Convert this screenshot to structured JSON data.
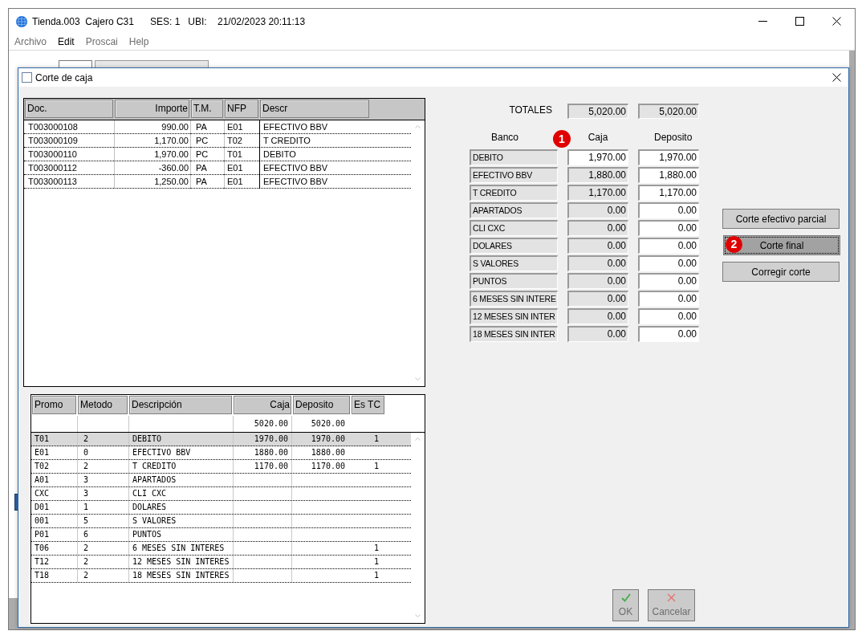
{
  "window": {
    "title": "Tienda.003  Cajero C31      SES: 1   UBI:    21/02/2023 20:11:13",
    "menu": [
      {
        "label": "Archivo",
        "disabled": true
      },
      {
        "label": "Edit",
        "disabled": false
      },
      {
        "label": "Proscai",
        "disabled": true
      },
      {
        "label": "Help",
        "disabled": true
      }
    ]
  },
  "dialog": {
    "title": "Corte de caja",
    "documents": {
      "columns": [
        "Doc.",
        "Importe",
        "T.M.",
        "NFP",
        "Descr"
      ],
      "rows": [
        {
          "doc": "T003000108",
          "importe": "990.00",
          "tm": "PA",
          "nfp": "E01",
          "descr": "EFECTIVO BBV"
        },
        {
          "doc": "T003000109",
          "importe": "1,170.00",
          "tm": "PC",
          "nfp": "T02",
          "descr": "T CREDITO"
        },
        {
          "doc": "T003000110",
          "importe": "1,970.00",
          "tm": "PC",
          "nfp": "T01",
          "descr": "DEBITO"
        },
        {
          "doc": "T003000112",
          "importe": "-360.00",
          "tm": "PA",
          "nfp": "E01",
          "descr": "EFECTIVO BBV"
        },
        {
          "doc": "T003000113",
          "importe": "1,250.00",
          "tm": "PA",
          "nfp": "E01",
          "descr": "EFECTIVO BBV"
        }
      ]
    },
    "totals": {
      "label": "TOTALES",
      "caja": "5,020.00",
      "deposito": "5,020.00"
    },
    "bank_headers": {
      "banco": "Banco",
      "caja": "Caja",
      "deposito": "Deposito",
      "callout": "1"
    },
    "banks": [
      {
        "name": "DEBITO",
        "caja": "1,970.00",
        "caja_disabled": false,
        "deposito": "1,970.00"
      },
      {
        "name": "EFECTIVO BBV",
        "caja": "1,880.00",
        "caja_disabled": true,
        "deposito": "1,880.00"
      },
      {
        "name": "T CREDITO",
        "caja": "1,170.00",
        "caja_disabled": true,
        "deposito": "1,170.00"
      },
      {
        "name": "APARTADOS",
        "caja": "0.00",
        "caja_disabled": true,
        "deposito": "0.00"
      },
      {
        "name": "CLI CXC",
        "caja": "0.00",
        "caja_disabled": true,
        "deposito": "0.00"
      },
      {
        "name": "DOLARES",
        "caja": "0.00",
        "caja_disabled": true,
        "deposito": "0.00"
      },
      {
        "name": "S VALORES",
        "caja": "0.00",
        "caja_disabled": true,
        "deposito": "0.00"
      },
      {
        "name": "PUNTOS",
        "caja": "0.00",
        "caja_disabled": true,
        "deposito": "0.00"
      },
      {
        "name": "6 MESES SIN INTERE",
        "caja": "0.00",
        "caja_disabled": true,
        "deposito": "0.00"
      },
      {
        "name": "12 MESES SIN INTER",
        "caja": "0.00",
        "caja_disabled": true,
        "deposito": "0.00"
      },
      {
        "name": "18 MESES SIN INTER",
        "caja": "0.00",
        "caja_disabled": true,
        "deposito": "0.00"
      }
    ],
    "actions": [
      {
        "label": "Corte efectivo parcial",
        "focused": false
      },
      {
        "label": "Corte final",
        "focused": true,
        "callout": "2"
      },
      {
        "label": "Corregir corte",
        "focused": false
      }
    ],
    "promos": {
      "columns": [
        "Promo",
        "Metodo",
        "Descripción",
        "Caja",
        "Deposito",
        "Es TC"
      ],
      "totals": {
        "caja": "5020.00",
        "deposito": "5020.00"
      },
      "rows": [
        {
          "promo": "T01",
          "metodo": "2",
          "descripcion": "DEBITO",
          "caja": "1970.00",
          "deposito": "1970.00",
          "es_tc": "1",
          "selected": true
        },
        {
          "promo": "E01",
          "metodo": "0",
          "descripcion": "EFECTIVO BBV",
          "caja": "1880.00",
          "deposito": "1880.00",
          "selected": false
        },
        {
          "promo": "T02",
          "metodo": "2",
          "descripcion": "T CREDITO",
          "caja": "1170.00",
          "deposito": "1170.00",
          "es_tc": "1",
          "selected": false
        },
        {
          "promo": "A01",
          "metodo": "3",
          "descripcion": "APARTADOS",
          "selected": false
        },
        {
          "promo": "CXC",
          "metodo": "3",
          "descripcion": "CLI CXC",
          "selected": false
        },
        {
          "promo": "D01",
          "metodo": "1",
          "descripcion": "DOLARES",
          "selected": false
        },
        {
          "promo": "001",
          "metodo": "5",
          "descripcion": "S VALORES",
          "selected": false
        },
        {
          "promo": "P01",
          "metodo": "6",
          "descripcion": "PUNTOS",
          "selected": false
        },
        {
          "promo": "T06",
          "metodo": "2",
          "descripcion": "6 MESES SIN INTERES",
          "es_tc": "1",
          "selected": false
        },
        {
          "promo": "T12",
          "metodo": "2",
          "descripcion": "12 MESES SIN INTERES",
          "es_tc": "1",
          "selected": false
        },
        {
          "promo": "T18",
          "metodo": "2",
          "descripcion": "18 MESES SIN INTERES",
          "es_tc": "1",
          "selected": false
        }
      ]
    },
    "footer_buttons": [
      {
        "kind": "ok",
        "label": "OK",
        "disabled": true
      },
      {
        "kind": "cancel",
        "label": "Cancelar",
        "disabled": true
      }
    ]
  }
}
